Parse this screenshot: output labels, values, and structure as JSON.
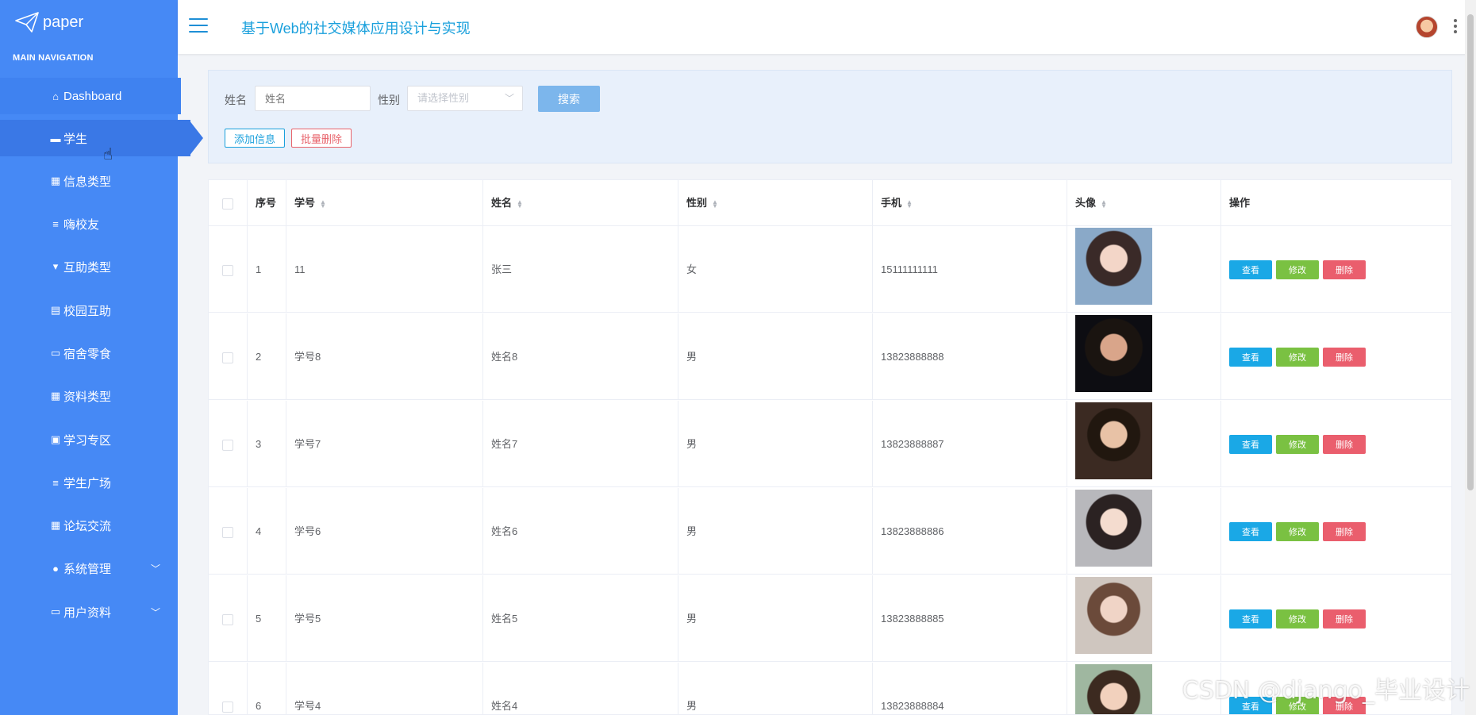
{
  "app": {
    "logo_text": "paper",
    "title": "基于Web的社交媒体应用设计与实现"
  },
  "sidebar": {
    "header": "MAIN NAVIGATION",
    "items": [
      {
        "label": "Dashboard",
        "icon": "home-icon"
      },
      {
        "label": "学生",
        "icon": "chat-icon"
      },
      {
        "label": "信息类型",
        "icon": "grid-icon"
      },
      {
        "label": "嗨校友",
        "icon": "list-icon"
      },
      {
        "label": "互助类型",
        "icon": "comment-icon"
      },
      {
        "label": "校园互助",
        "icon": "book-icon"
      },
      {
        "label": "宿舍零食",
        "icon": "briefcase-icon"
      },
      {
        "label": "资料类型",
        "icon": "grid-icon"
      },
      {
        "label": "学习专区",
        "icon": "clipboard-icon"
      },
      {
        "label": "学生广场",
        "icon": "list-icon"
      },
      {
        "label": "论坛交流",
        "icon": "grid-icon"
      },
      {
        "label": "系统管理",
        "icon": "user-icon"
      },
      {
        "label": "用户资料",
        "icon": "id-card-icon"
      }
    ]
  },
  "search": {
    "name_label": "姓名",
    "name_placeholder": "姓名",
    "gender_label": "性别",
    "gender_placeholder": "请选择性别",
    "search_button": "搜索",
    "add_button": "添加信息",
    "bulk_delete_button": "批量删除"
  },
  "table": {
    "columns": [
      "序号",
      "学号",
      "姓名",
      "性别",
      "手机",
      "头像",
      "操作"
    ],
    "actions": {
      "view": "查看",
      "edit": "修改",
      "delete": "删除"
    },
    "rows": [
      {
        "index": "1",
        "student_no": "11",
        "name": "张三",
        "gender": "女",
        "phone": "15111111111"
      },
      {
        "index": "2",
        "student_no": "学号8",
        "name": "姓名8",
        "gender": "男",
        "phone": "13823888888"
      },
      {
        "index": "3",
        "student_no": "学号7",
        "name": "姓名7",
        "gender": "男",
        "phone": "13823888887"
      },
      {
        "index": "4",
        "student_no": "学号6",
        "name": "姓名6",
        "gender": "男",
        "phone": "13823888886"
      },
      {
        "index": "5",
        "student_no": "学号5",
        "name": "姓名5",
        "gender": "男",
        "phone": "13823888885"
      },
      {
        "index": "6",
        "student_no": "学号4",
        "name": "姓名4",
        "gender": "男",
        "phone": "13823888884"
      }
    ]
  },
  "watermark": "CSDN @django_毕业设计",
  "colors": {
    "sidebar": "#4689f5",
    "accent": "#1aa0dc",
    "view": "#1aa8e6",
    "edit": "#7ac142",
    "delete": "#ea5e6d"
  }
}
